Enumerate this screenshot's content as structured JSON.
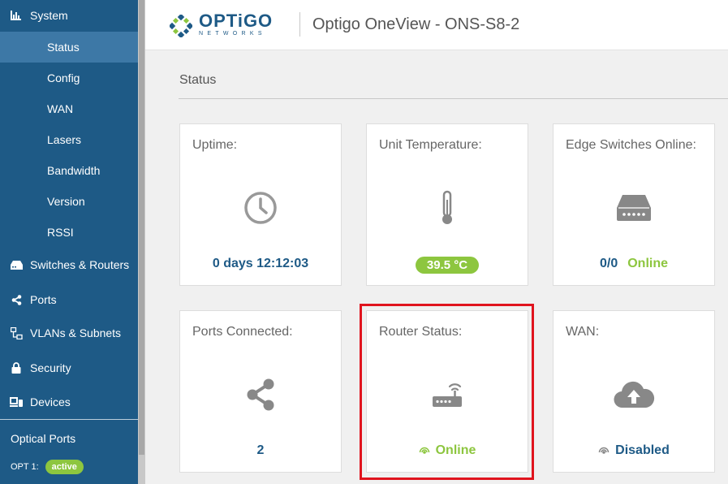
{
  "sidebar": {
    "system_label": "System",
    "sub_items": [
      "Status",
      "Config",
      "WAN",
      "Lasers",
      "Bandwidth",
      "Version",
      "RSSI"
    ],
    "items": [
      "Switches & Routers",
      "Ports",
      "VLANs & Subnets",
      "Security",
      "Devices"
    ],
    "optical_label": "Optical Ports",
    "opt1_label": "OPT 1:",
    "opt1_status": "active"
  },
  "header": {
    "logo_main": "OPTiGO",
    "logo_sub": "NETWORKS",
    "title": "Optigo OneView - ONS-S8-2"
  },
  "main": {
    "section_title": "Status",
    "cards": {
      "uptime": {
        "label": "Uptime:",
        "value": "0 days 12:12:03",
        "icon": "clock-icon"
      },
      "temperature": {
        "label": "Unit Temperature:",
        "value": "39.5 °C",
        "icon": "thermometer-icon"
      },
      "edge": {
        "label": "Edge Switches Online:",
        "count": "0/0",
        "status": "Online",
        "icon": "switch-icon"
      },
      "ports": {
        "label": "Ports Connected:",
        "value": "2",
        "icon": "share-icon"
      },
      "router": {
        "label": "Router Status:",
        "status": "Online",
        "icon": "router-icon"
      },
      "wan": {
        "label": "WAN:",
        "status": "Disabled",
        "icon": "cloud-upload-icon"
      }
    }
  },
  "colors": {
    "sidebar": "#1e5a86",
    "active": "#3d78a6",
    "accent_green": "#8dc63f",
    "highlight": "#e0141e"
  }
}
